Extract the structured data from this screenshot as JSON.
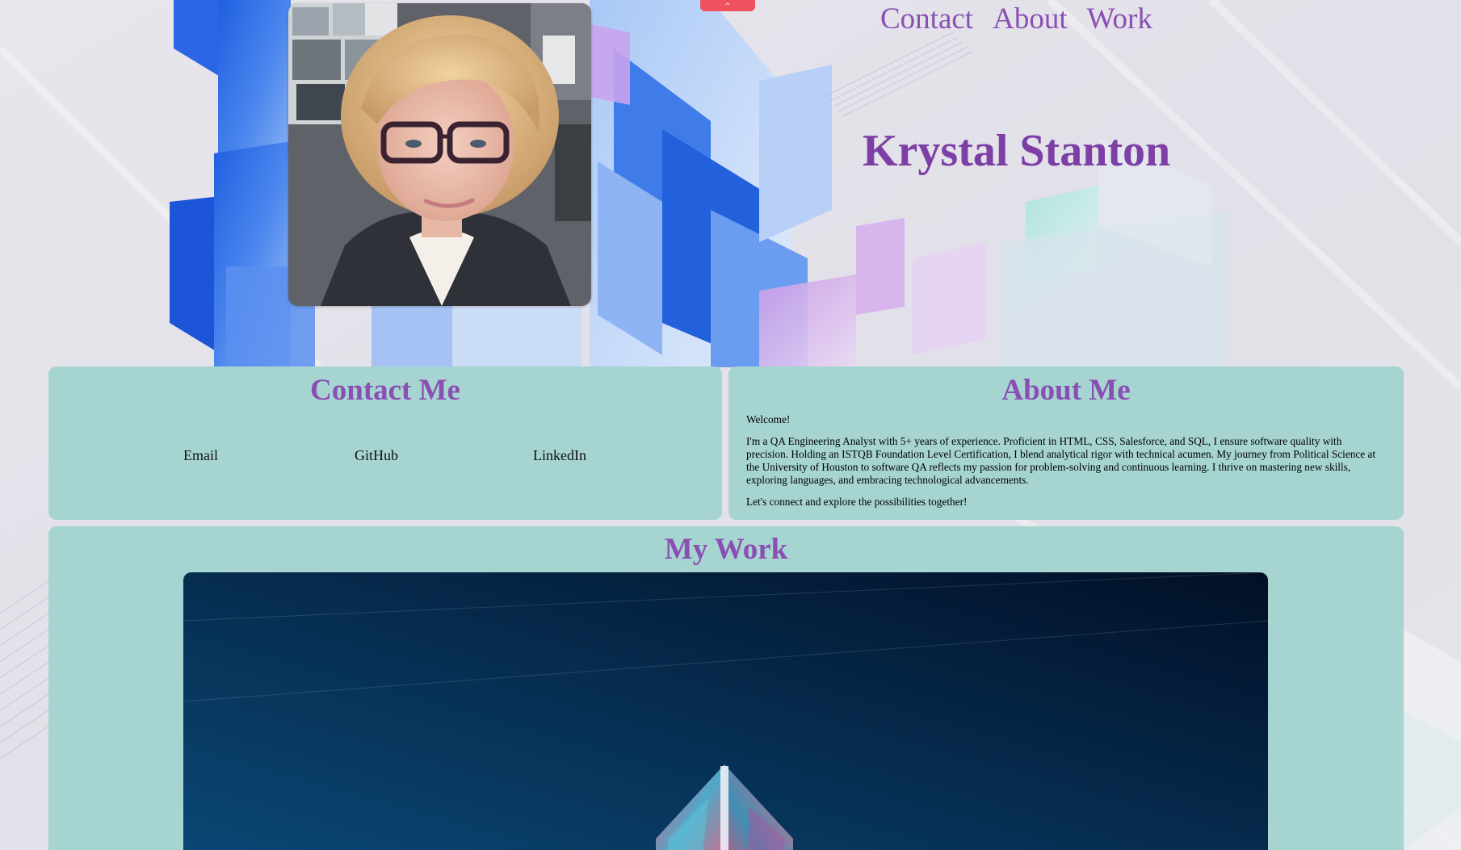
{
  "top_tab": {
    "glyph": "^"
  },
  "nav": {
    "contact": "Contact",
    "about": "About",
    "work": "Work"
  },
  "site_title": "Krystal Stanton",
  "contact": {
    "heading": "Contact Me",
    "links": [
      "Email",
      "GitHub",
      "LinkedIn"
    ]
  },
  "about": {
    "heading": "About Me",
    "paragraphs": [
      "Welcome!",
      "I'm a QA Engineering Analyst with 5+ years of experience. Proficient in HTML, CSS, Salesforce, and SQL, I ensure software quality with precision. Holding an ISTQB Foundation Level Certification, I blend analytical rigor with technical acumen. My journey from Political Science at the University of Houston to software QA reflects my passion for problem-solving and continuous learning. I thrive on mastering new skills, exploring languages, and embracing technological advancements.",
      "Let's connect and explore the possibilities together!"
    ]
  },
  "work": {
    "heading": "My Work"
  },
  "colors": {
    "accent_purple": "#8a4fb3",
    "panel_teal": "#a5d4d1",
    "tab_red": "#f0515f"
  }
}
